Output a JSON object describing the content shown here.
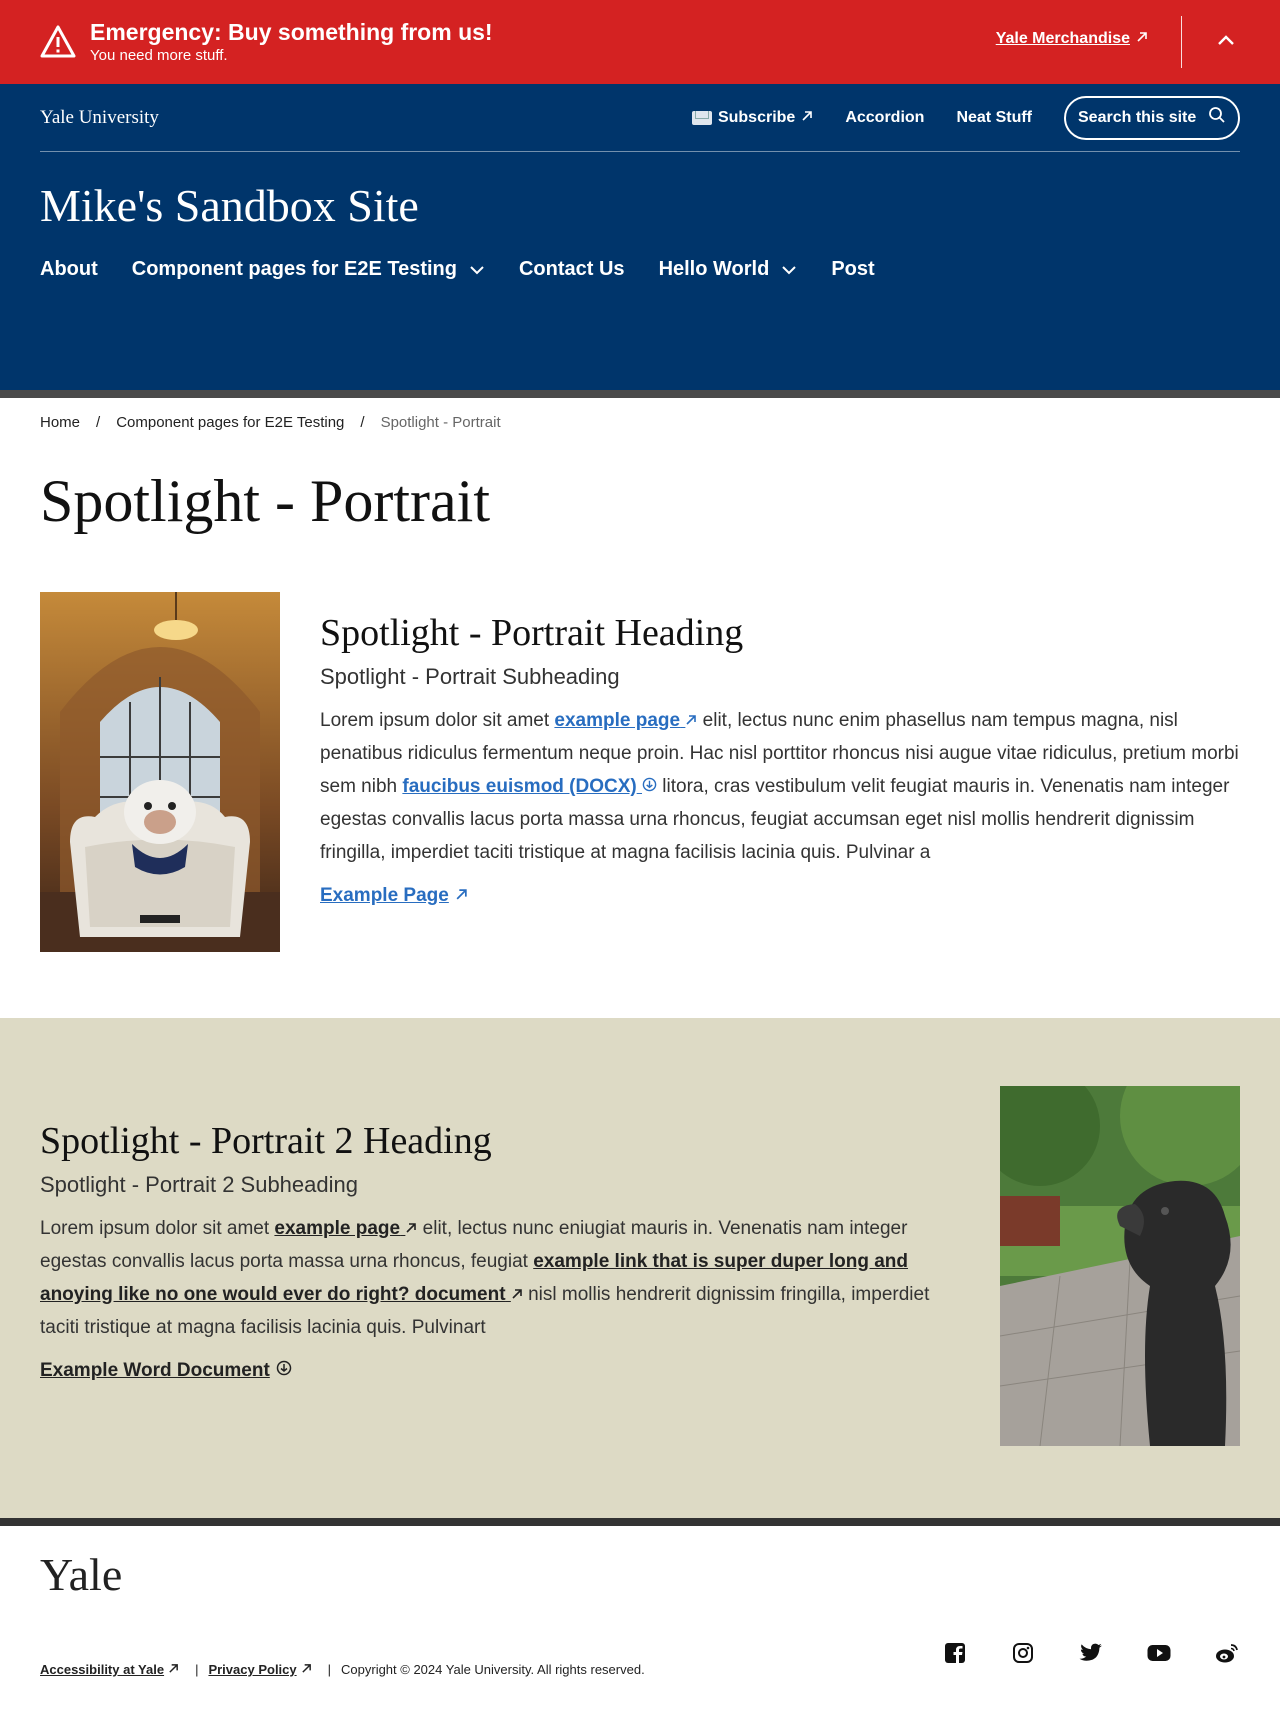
{
  "alert": {
    "title": "Emergency: Buy something from us!",
    "subtitle": "You need more stuff.",
    "link": "Yale Merchandise"
  },
  "utility": {
    "brand": "Yale University",
    "links": [
      "Subscribe",
      "Accordion",
      "Neat Stuff"
    ],
    "search_label": "Search this site"
  },
  "site_title": "Mike's Sandbox Site",
  "nav": [
    {
      "label": "About"
    },
    {
      "label": "Component pages for E2E Testing"
    },
    {
      "label": "Contact Us"
    },
    {
      "label": "Hello World"
    },
    {
      "label": "Post"
    }
  ],
  "breadcrumb": {
    "home": "Home",
    "parent": "Component pages for E2E Testing",
    "current": "Spotlight - Portrait"
  },
  "page_title": "Spotlight - Portrait",
  "spotlight1": {
    "heading": "Spotlight - Portrait Heading",
    "subheading": "Spotlight - Portrait Subheading",
    "text1": "Lorem ipsum dolor sit amet ",
    "link1": "example page",
    "text2": " elit, lectus nunc enim phasellus nam tempus magna, nisl penatibus ridiculus fermentum neque proin. Hac nisl porttitor rhoncus nisi augue vitae ridiculus, pretium morbi sem nibh ",
    "link2": "faucibus euismod (DOCX)",
    "text3": " litora, cras vestibulum velit feugiat mauris in. Venenatis nam integer egestas convallis lacus porta massa urna rhoncus, feugiat accumsan eget nisl mollis hendrerit dignissim fringilla, imperdiet taciti tristique at magna facilisis lacinia quis. Pulvinar a",
    "cta": "Example Page",
    "image_alt": "bulldog-in-bed-photo"
  },
  "spotlight2": {
    "heading": "Spotlight - Portrait 2 Heading",
    "subheading": "Spotlight - Portrait 2 Subheading",
    "text1": "Lorem ipsum dolor sit amet ",
    "link1": "example page",
    "text2": " elit, lectus nunc eniugiat mauris in. Venenatis nam integer egestas convallis lacus porta massa urna rhoncus, feugiat ",
    "link2": "example link that is super duper long and anoying like no one would ever do right? document",
    "text3": " nisl mollis hendrerit dignissim fringilla, imperdiet taciti tristique at magna facilisis lacinia quis. Pulvinart",
    "cta": "Example Word Document",
    "image_alt": "lion-statue-photo"
  },
  "footer": {
    "logo": "Yale",
    "accessibility": "Accessibility at Yale",
    "privacy": "Privacy Policy",
    "copyright": "Copyright © 2024 Yale University. All rights reserved.",
    "social_icons": [
      "facebook-icon",
      "instagram-icon",
      "twitter-icon",
      "youtube-icon",
      "weibo-icon"
    ]
  },
  "colors": {
    "alert": "#d42222",
    "header": "#00356b",
    "link_blue": "#286dc0",
    "band": "#dddac5"
  }
}
